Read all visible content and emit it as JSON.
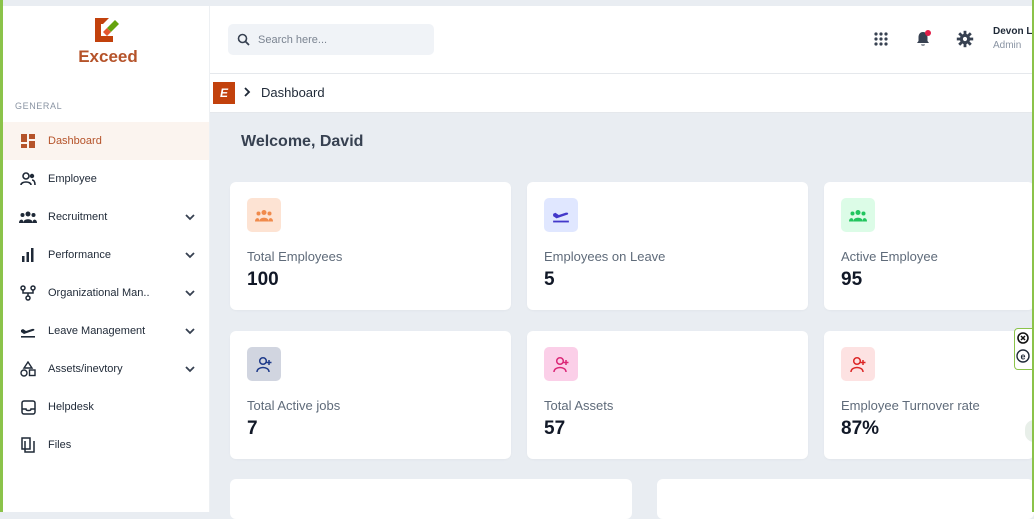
{
  "brand": {
    "name": "Exceed",
    "badge_letter": "E",
    "color": "#b5532a"
  },
  "sidebar": {
    "section": "GENERAL",
    "items": [
      {
        "label": "Dashboard",
        "icon": "dashboard-icon",
        "active": true,
        "expandable": false
      },
      {
        "label": "Employee",
        "icon": "people-icon",
        "active": false,
        "expandable": false
      },
      {
        "label": "Recruitment",
        "icon": "group-icon",
        "active": false,
        "expandable": true
      },
      {
        "label": "Performance",
        "icon": "bar-chart-icon",
        "active": false,
        "expandable": true
      },
      {
        "label": "Organizational Man..",
        "icon": "org-chart-icon",
        "active": false,
        "expandable": true
      },
      {
        "label": "Leave Management",
        "icon": "airplane-icon",
        "active": false,
        "expandable": true
      },
      {
        "label": "Assets/inevtory",
        "icon": "shapes-icon",
        "active": false,
        "expandable": true
      },
      {
        "label": "Helpdesk",
        "icon": "inbox-icon",
        "active": false,
        "expandable": false
      },
      {
        "label": "Files",
        "icon": "files-icon",
        "active": false,
        "expandable": false
      }
    ]
  },
  "header": {
    "search_placeholder": "Search here...",
    "user_name": "Devon L",
    "user_role": "Admin",
    "notification_color": "#e11d48"
  },
  "breadcrumb": {
    "current": "Dashboard"
  },
  "main": {
    "welcome": "Welcome, David",
    "cards": [
      {
        "label": "Total Employees",
        "value": "100",
        "icon": "group-icon",
        "bg": "#fde3d3",
        "fg": "#f08a4b"
      },
      {
        "label": "Employees on Leave",
        "value": "5",
        "icon": "airplane-icon",
        "bg": "#e0e7ff",
        "fg": "#4338ca"
      },
      {
        "label": "Active Employee",
        "value": "95",
        "icon": "group-icon",
        "bg": "#dcfce7",
        "fg": "#22c55e"
      },
      {
        "label": "Total Active jobs",
        "value": "7",
        "icon": "user-add-icon",
        "bg": "#d1d5e0",
        "fg": "#1e3a8a"
      },
      {
        "label": "Total Assets",
        "value": "57",
        "icon": "user-add-icon",
        "bg": "#fbcfe8",
        "fg": "#db2777"
      },
      {
        "label": "Employee Turnover rate",
        "value": "87%",
        "icon": "user-add-icon",
        "bg": "#fde2e2",
        "fg": "#dc2626"
      }
    ]
  }
}
